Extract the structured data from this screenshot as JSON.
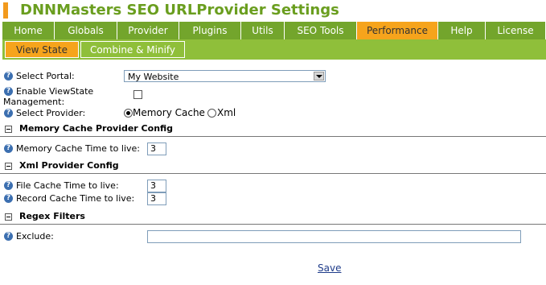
{
  "title": "DNNMasters SEO URLProvider Settings",
  "main_tabs": [
    "Home",
    "Globals",
    "Provider",
    "Plugins",
    "Utils",
    "SEO Tools",
    "Performance",
    "Help",
    "License"
  ],
  "main_tabs_active": "Performance",
  "sub_tabs": [
    "View State",
    "Combine & Minify"
  ],
  "sub_tabs_active": "View State",
  "form": {
    "select_portal_label": "Select Portal:",
    "select_portal_value": "My Website",
    "enable_viewstate_label_line1": "Enable ViewState",
    "enable_viewstate_label_line2": "Management:",
    "select_provider_label": "Select Provider:",
    "provider_option_memory": "Memory Cache",
    "provider_option_xml": "Xml",
    "selected_provider": "Memory Cache"
  },
  "sections": {
    "memory": {
      "title": "Memory Cache Provider Config",
      "time_label": "Memory Cache Time to live:",
      "time_value": "3"
    },
    "xml": {
      "title": "Xml Provider Config",
      "file_label": "File Cache Time to live:",
      "file_value": "3",
      "record_label": "Record Cache Time to live:",
      "record_value": "3"
    },
    "regex": {
      "title": "Regex Filters",
      "exclude_label": "Exclude:",
      "exclude_value": ""
    }
  },
  "save_label": "Save",
  "colors": {
    "title_green": "#6a9e1f",
    "tab_green": "#73a52c",
    "subnav_green": "#8fbf3a",
    "active_orange": "#f6a41c"
  }
}
